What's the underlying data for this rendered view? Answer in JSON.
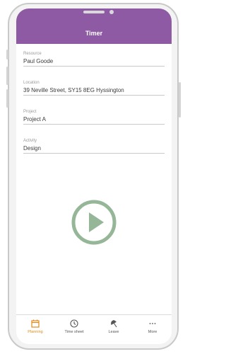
{
  "header": {
    "title": "Timer"
  },
  "fields": [
    {
      "label": "Resource",
      "value": "Paul Goode"
    },
    {
      "label": "Location",
      "value": "39 Neville Street, SY15 8EG Hyssington"
    },
    {
      "label": "Project",
      "value": "Project A"
    },
    {
      "label": "Activity",
      "value": "Design"
    }
  ],
  "play_button": {
    "icon": "play-icon",
    "color": "#95b697"
  },
  "tabs": [
    {
      "label": "Planning",
      "icon": "calendar-icon",
      "active": true
    },
    {
      "label": "Time sheet",
      "icon": "clock-icon",
      "active": false
    },
    {
      "label": "Leave",
      "icon": "umbrella-icon",
      "active": false
    },
    {
      "label": "More",
      "icon": "more-icon",
      "active": false
    }
  ],
  "colors": {
    "header": "#8e5aa3",
    "accent": "#e08a1c"
  }
}
